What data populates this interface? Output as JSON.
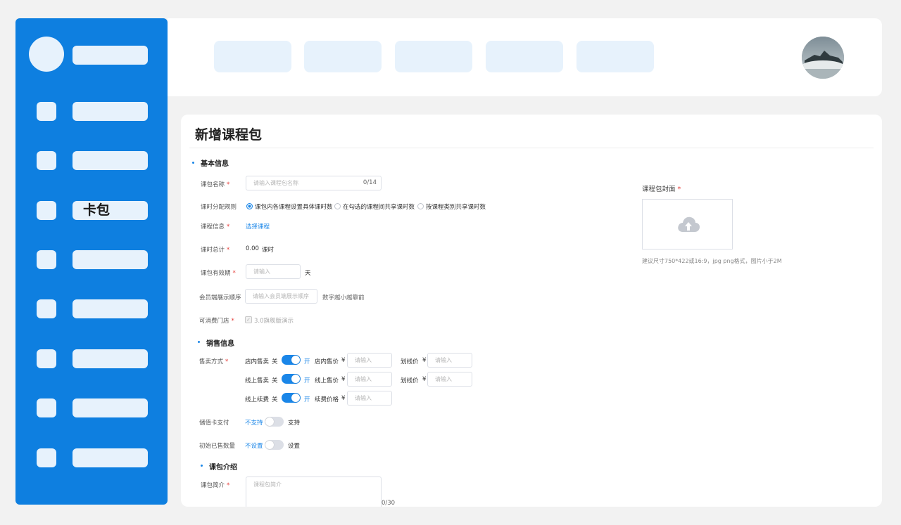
{
  "sidebar": {
    "active_item_label": "卡包"
  },
  "main": {
    "page_title": "新增课程包",
    "basic_section": {
      "title": "基本信息",
      "name_label": "课包名称",
      "name_placeholder": "请输入课程包名称",
      "name_count": "0/14",
      "rule_label": "课时分配规则",
      "rule_options": [
        "课包内各课程设置具体课时数",
        "在勾选的课程间共享课时数",
        "按课程类别共享课时数"
      ],
      "course_info_label": "课程信息",
      "select_course_link": "选择课程",
      "total_label": "课时总计",
      "total_value": "0.00",
      "total_unit": "课时",
      "validity_label": "课包有效期",
      "validity_placeholder": "请输入",
      "validity_unit": "天",
      "order_label": "会员端展示顺序",
      "order_placeholder": "请输入会员端展示顺序",
      "order_hint": "数字越小越靠前",
      "store_label": "可消费门店",
      "store_option": "3.0旗舰版演示"
    },
    "sales_section": {
      "title": "销售信息",
      "method_label": "售卖方式",
      "off_label": "关",
      "on_label": "开",
      "currency": "¥",
      "placeholder": "请输入",
      "rows": [
        {
          "mode": "店内售卖",
          "price_label": "店内售价",
          "strike_label": "划线价"
        },
        {
          "mode": "线上售卖",
          "price_label": "线上售价",
          "strike_label": "划线价"
        },
        {
          "mode": "线上续费",
          "price_label": "续费价格"
        }
      ],
      "stored_card_label": "储值卡支付",
      "stored_card_off": "不支持",
      "stored_card_on": "支持",
      "sold_label": "初始已售数量",
      "sold_off": "不设置",
      "sold_on": "设置"
    },
    "intro_section": {
      "title": "课包介绍",
      "brief_label": "课包简介",
      "brief_placeholder": "课程包简介",
      "brief_count": "0/30"
    },
    "cover": {
      "label": "课程包封面",
      "hint": "建议尺寸750*422或16:9，jpg png格式，图片小于2M"
    }
  },
  "colors": {
    "primary": "#0e7fe0",
    "accent": "#1a86e8",
    "placeholder_block": "#e7f2fc",
    "required": "#e53935"
  }
}
